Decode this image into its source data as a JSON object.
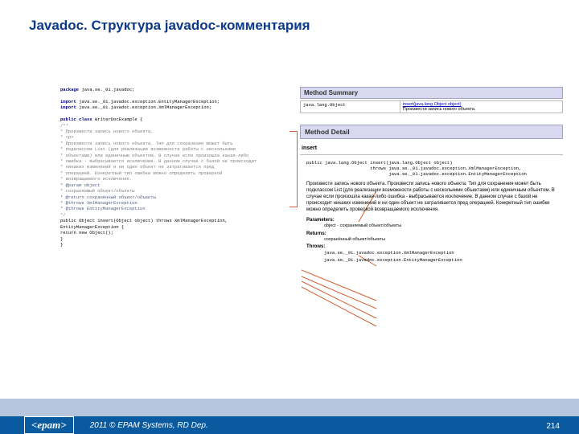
{
  "title": "Javadoc. Структура javadoc-комментария",
  "code": {
    "l1": "package java.se._01.javadoc;",
    "l2": "import java.se._01.javadoc.exception.EntityManagerException;",
    "l3": "import java.se._01.javadoc.exception.XmlManagerException;",
    "l4": "public class WriterDocExample {",
    "l5": "    /**",
    "l6": "     * Произвести запись нового объекта.",
    "l7": "     * <p>",
    "l8": "     * Произвести запись нового объекта. Тип для сохранения может быть",
    "l9": "     * подклассом List (для реализации возможности работы с несколькими",
    "l10": "     * объектами) или единичным объектом. В случае если произошла какая-либо",
    "l11": "     * ошибка - выбрасывается исключение. В данном случае с базой не происходит",
    "l12": "     * никаких изменений и ни один объект не  затрагивается пред",
    "l13": "     * операцией. Конкретный тип ошибки можно определить проверкой",
    "l14": "     * возвращаемого исключения.",
    "l15": "     * @param object",
    "l16": "     * сохраняемый объект/объекты",
    "l17": "     * @return сохранённый объект/объекты",
    "l18": "     * @throws XmlManagerException",
    "l19": "     * @throws EntityManagerException",
    "l20": "     */",
    "l21": "    public Object insert(Object object) throws XmlManagerException,",
    "l22": "EntityManagerException {",
    "l23": "        return new Object();",
    "l24": "    }",
    "l25": "}"
  },
  "doc": {
    "summary_hdr": "Method Summary",
    "summary_ret": "java.lang.Object",
    "summary_sig": "insert(java.lang.Object object)",
    "summary_brief": "          Произвести запись нового объекта.",
    "detail_hdr": "Method Detail",
    "method_name": "insert",
    "sig1": "public java.lang.Object insert(java.lang.Object object)",
    "sig2": "                        throws java.se._01.javadoc.exception.XmlManagerException,",
    "sig3": "                               java.se._01.javadoc.exception.EntityManagerException",
    "description": "Произвести запись нового объекта. Произвести запись нового объекта. Тип для сохранения может быть подклассом List (для реализации возможности работы с несколькими объектами) или единичным объектом. В случае если произошла какая-либо ошибка - выбрасывается исключение. В данном случае с базой не происходит никаких изменений и ни один объект не затрагивается пред операцией. Конкретный тип ошибки можно определить проверкой возвращаемого исключения.",
    "param_label": "Parameters:",
    "param_text": "object - сохраняемый объект/объекты",
    "return_label": "Returns:",
    "return_text": "сохранённый объект/объекты",
    "throws_label": "Throws:",
    "throws1": "java.se._01.javadoc.exception.XmlManagerException",
    "throws2": "java.se._01.javadoc.exception.EntityManagerException"
  },
  "footer": {
    "logo": "<epam>",
    "copy": "2011 © EPAM Systems, RD Dep.",
    "page": "214"
  }
}
